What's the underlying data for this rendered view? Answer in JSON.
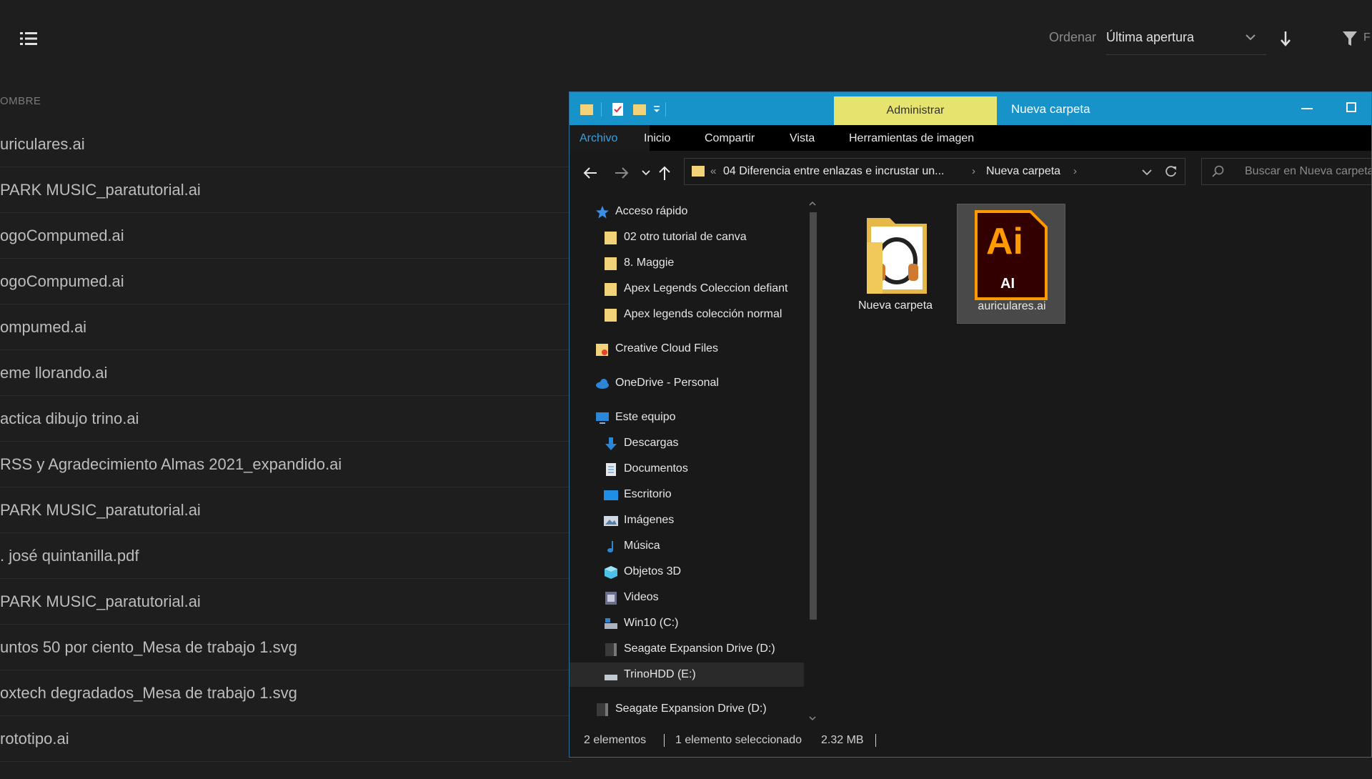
{
  "app": {
    "sort_label": "Ordenar",
    "sort_value": "Última apertura",
    "filter_text": "F",
    "column_header": "OMBRE",
    "files": [
      "uriculares.ai",
      "PARK MUSIC_paratutorial.ai",
      "ogoCompumed.ai",
      "ogoCompumed.ai",
      "ompumed.ai",
      "eme llorando.ai",
      "actica dibujo trino.ai",
      "RSS y Agradecimiento Almas 2021_expandido.ai",
      "PARK MUSIC_paratutorial.ai",
      ". josé quintanilla.pdf",
      "PARK MUSIC_paratutorial.ai",
      "untos 50 por ciento_Mesa de trabajo 1.svg",
      "oxtech degradados_Mesa de trabajo 1.svg",
      "rototipo.ai"
    ]
  },
  "explorer": {
    "tool_tab": "Administrar",
    "title": "Nueva carpeta",
    "ribbon": {
      "archivo": "Archivo",
      "inicio": "Inicio",
      "compartir": "Compartir",
      "vista": "Vista",
      "herramientas": "Herramientas de imagen"
    },
    "address": {
      "overflow": "«",
      "crumb1": "04 Diferencia entre enlazas e incrustar un...",
      "crumb2": "Nueva carpeta",
      "sep": "›"
    },
    "search_placeholder": "Buscar en Nueva carpeta",
    "nav": {
      "acceso_rapido": "Acceso rápido",
      "qa1": "02 otro tutorial de canva",
      "qa2": "8. Maggie",
      "qa3": "Apex Legends Coleccion defiant",
      "qa4": "Apex legends colección normal",
      "ccf": "Creative Cloud Files",
      "onedrive": "OneDrive - Personal",
      "este_equipo": "Este equipo",
      "descargas": "Descargas",
      "documentos": "Documentos",
      "escritorio": "Escritorio",
      "imagenes": "Imágenes",
      "musica": "Música",
      "objetos3d": "Objetos 3D",
      "videos": "Videos",
      "win10": "Win10 (C:)",
      "seagate1": "Seagate Expansion Drive (D:)",
      "trino": "TrinoHDD (E:)",
      "seagate2": "Seagate Expansion Drive (D:)"
    },
    "items": {
      "folder": "Nueva carpeta",
      "ai_file": "auriculares.ai",
      "ai_badge": "Ai",
      "ai_sub": "AI"
    },
    "status": {
      "count": "2 elementos",
      "selected": "1 elemento seleccionado",
      "size": "2.32 MB"
    },
    "colors": {
      "titlebar": "#1893c9",
      "tool_tab": "#e6e36e",
      "accent": "#3aa0e0",
      "ai_orange": "#ff9a00",
      "ai_bg": "#330000"
    }
  }
}
